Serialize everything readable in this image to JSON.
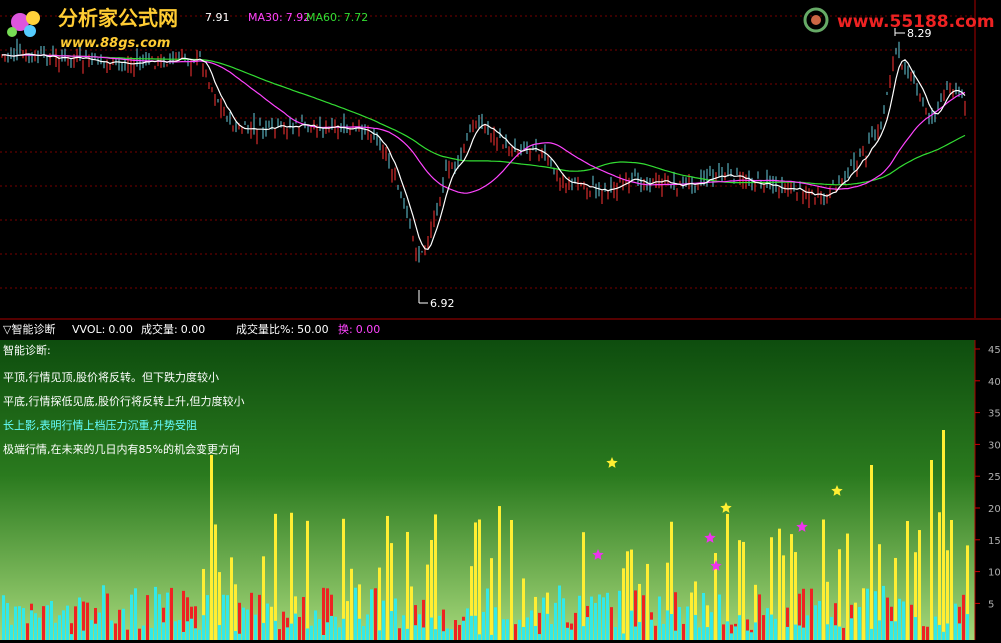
{
  "header": {
    "logo_title": "分析家公式网",
    "logo_url": "www.88gs.com",
    "watermark": "www.55188.com",
    "ma_values": [
      {
        "label": "",
        "value": "7.91",
        "color": "#ffffff"
      },
      {
        "label": "MA30:",
        "value": "7.92",
        "color": "#ff44ff"
      },
      {
        "label": "MA60:",
        "value": "7.72",
        "color": "#33dd33"
      }
    ]
  },
  "price_panel": {
    "high_label": "8.29",
    "low_label": "6.92",
    "candles_colors": {
      "up": "#ff3333",
      "down": "#66ccdd",
      "ma5": "#ffffff",
      "ma30": "#ff44ff",
      "ma60": "#33dd33"
    }
  },
  "indicator_bar": {
    "name": "▽智能诊断",
    "items": [
      {
        "label": "VVOL:",
        "value": "0.00",
        "color": "#ffffff"
      },
      {
        "label": "成交量:",
        "value": "0.00",
        "color": "#ffffff"
      },
      {
        "label": "成交量比%:",
        "value": "50.00",
        "color": "#ffffff"
      },
      {
        "label": "换:",
        "value": "0.00",
        "color": "#ff44ff"
      }
    ]
  },
  "diagnosis": {
    "title": "智能诊断:",
    "lines": [
      {
        "text": "平顶,行情见顶,股价将反转。但下跌力度较小",
        "color": "#ffffff"
      },
      {
        "text": "平底,行情探低见底,股价行将反转上升,但力度较小",
        "color": "#ffffff"
      },
      {
        "text": "长上影,表明行情上档压力沉重,升势受阻",
        "color": "#66ffff"
      },
      {
        "text": "极端行情,在未来的几日内有85%的机会变更方向",
        "color": "#ffffff"
      }
    ]
  },
  "axis": {
    "ticks": [
      "45",
      "40",
      "35",
      "30",
      "25",
      "20",
      "15",
      "10",
      "5"
    ]
  },
  "colors": {
    "panel_bg_top": "#0e5a0e",
    "panel_bg_bottom": "#9ad46c",
    "yellow_bar": "#ffee33",
    "red_bar": "#ee2222",
    "cyan_bar": "#33e8e8",
    "star": "#ee33ee",
    "star_yellow": "#ffee33"
  }
}
